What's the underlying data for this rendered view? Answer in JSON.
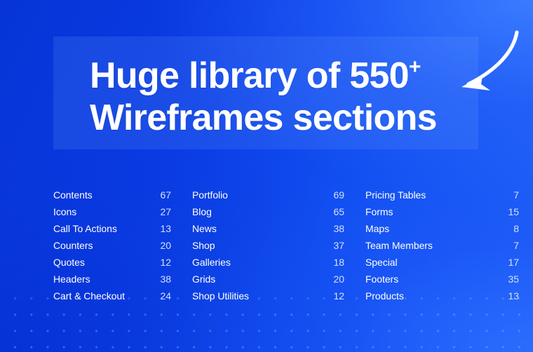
{
  "headline": {
    "line1_text": "Huge library of 550",
    "line1_suffix": "+",
    "line2_text": "Wireframes sections"
  },
  "arrow": {
    "icon": "curved-arrow-down-left-icon"
  },
  "colors": {
    "background_deep": "#0634d6",
    "background_bright": "#2363f8",
    "panel_overlay": "rgba(120,165,255,0.16)",
    "label_text": "#ffffff",
    "count_text": "#d3e0ff",
    "dot_grid": "rgba(150,185,255,0.33)"
  },
  "columns": [
    {
      "name": "column-1",
      "rows": [
        {
          "label": "Contents",
          "count": "67"
        },
        {
          "label": "Icons",
          "count": "27"
        },
        {
          "label": "Call To Actions",
          "count": "13"
        },
        {
          "label": "Counters",
          "count": "20"
        },
        {
          "label": "Quotes",
          "count": "12"
        },
        {
          "label": "Headers",
          "count": "38"
        },
        {
          "label": "Cart & Checkout",
          "count": "24"
        }
      ]
    },
    {
      "name": "column-2",
      "rows": [
        {
          "label": "Portfolio",
          "count": "69"
        },
        {
          "label": "Blog",
          "count": "65"
        },
        {
          "label": "News",
          "count": "38"
        },
        {
          "label": "Shop",
          "count": "37"
        },
        {
          "label": "Galleries",
          "count": "18"
        },
        {
          "label": "Grids",
          "count": "20"
        },
        {
          "label": "Shop Utilities",
          "count": "12"
        }
      ]
    },
    {
      "name": "column-3",
      "rows": [
        {
          "label": "Pricing Tables",
          "count": "7"
        },
        {
          "label": "Forms",
          "count": "15"
        },
        {
          "label": "Maps",
          "count": "8"
        },
        {
          "label": "Team Members",
          "count": "7"
        },
        {
          "label": "Special",
          "count": "17"
        },
        {
          "label": "Footers",
          "count": "35"
        },
        {
          "label": "Products",
          "count": "13"
        }
      ]
    }
  ]
}
